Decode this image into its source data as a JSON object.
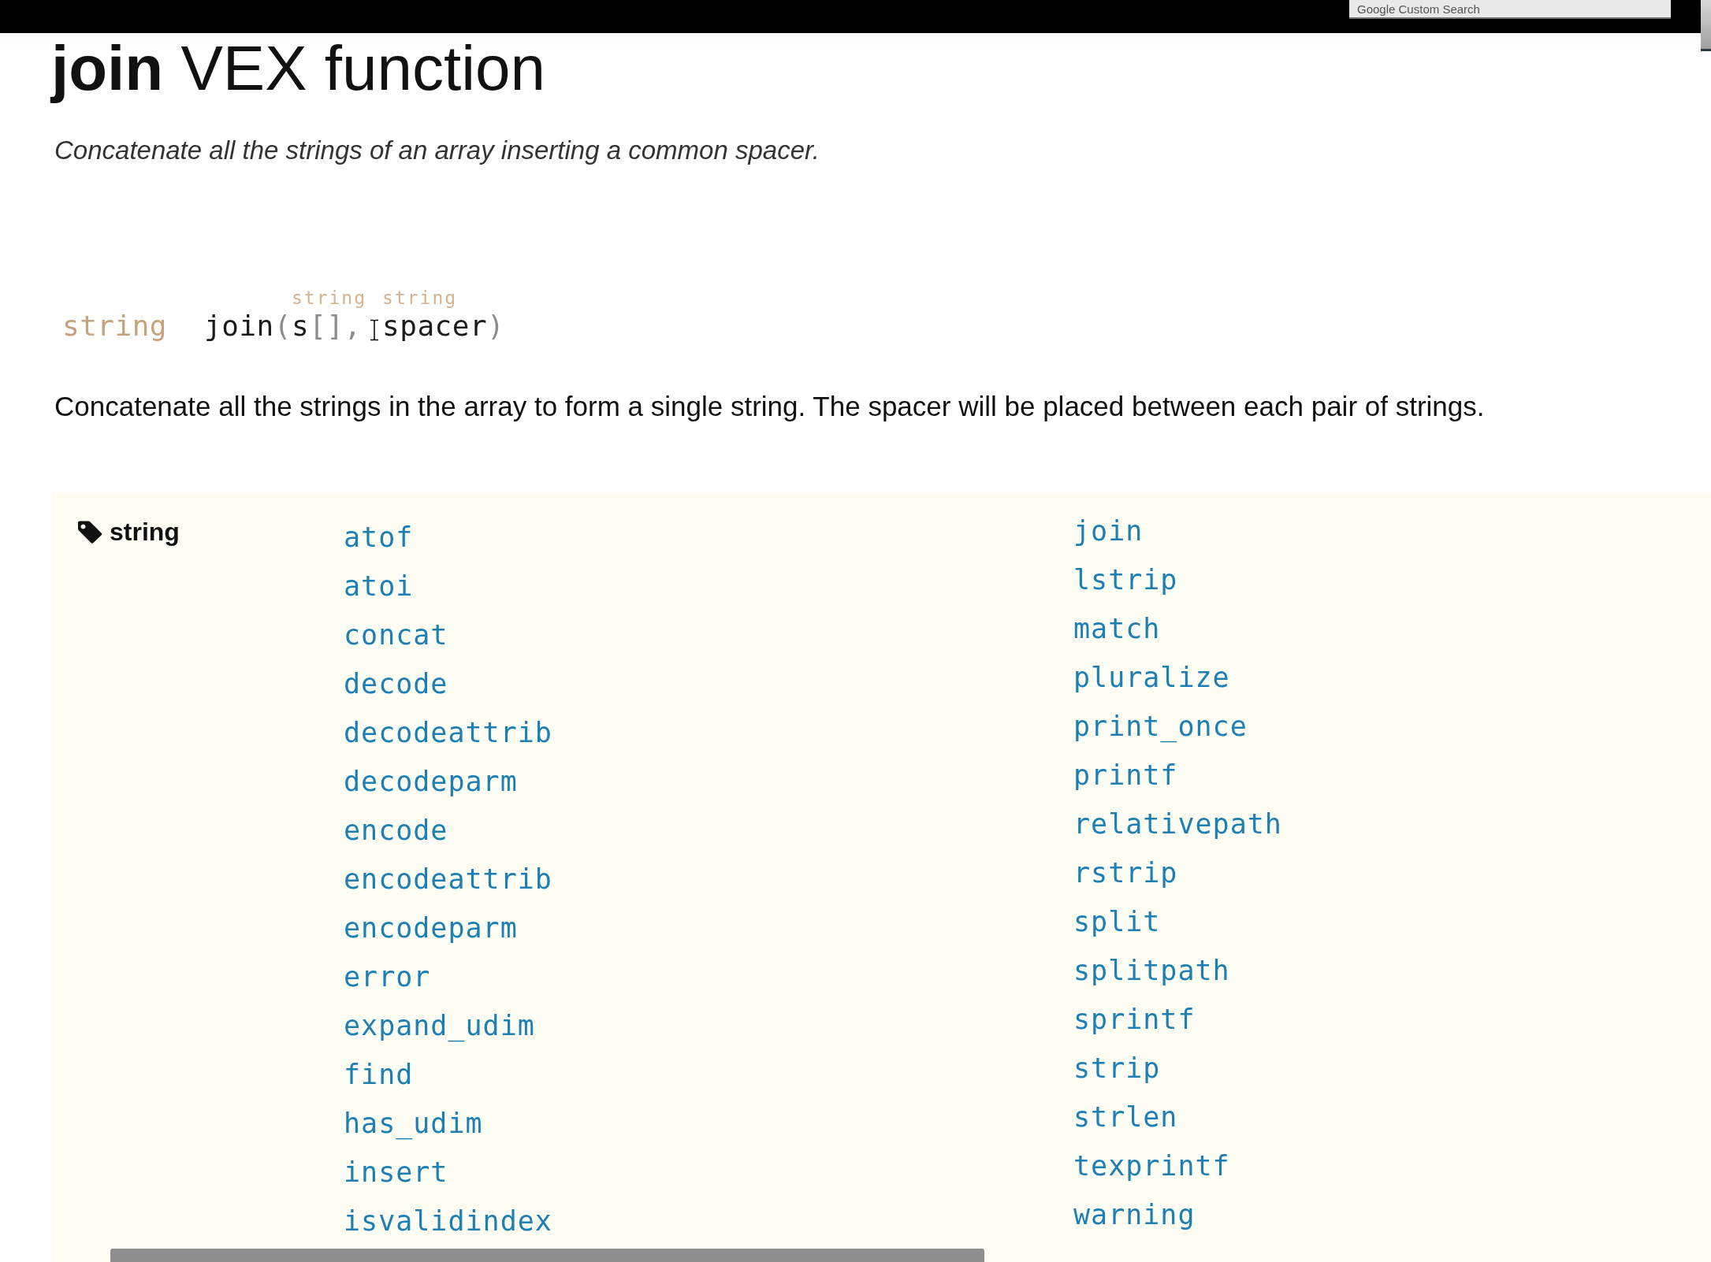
{
  "top_bar": {
    "search": {
      "placeholder": "Google Custom Search"
    }
  },
  "title": "**join** VEX function",
  "summary": "Concatenate all the strings of an array inserting a common spacer.",
  "signature": {
    "return_type": "string",
    "name": "join",
    "open": "(",
    "separator": ",",
    "close": ")",
    "params": [
      {
        "type": "string",
        "name": "s",
        "brackets": "[]"
      },
      {
        "type": "string",
        "name": "spacer"
      }
    ]
  },
  "description": "Concatenate all the strings in the array to form a single string. The spacer will be placed between each pair of strings.",
  "related": {
    "tag": "string",
    "columns": [
      {
        "items": [
          "atof",
          "atoi",
          "concat",
          "decode",
          "decodeattrib",
          "decodeparm",
          "encode",
          "encodeattrib",
          "encodeparm",
          "error",
          "expand_udim",
          "find",
          "has_udim",
          "insert",
          "isvalidindex"
        ]
      },
      {
        "items": [
          "join",
          "lstrip",
          "match",
          "pluralize",
          "print_once",
          "printf",
          "relativepath",
          "rstrip",
          "split",
          "splitpath",
          "sprintf",
          "strip",
          "strlen",
          "texprintf",
          "warning"
        ]
      }
    ]
  }
}
